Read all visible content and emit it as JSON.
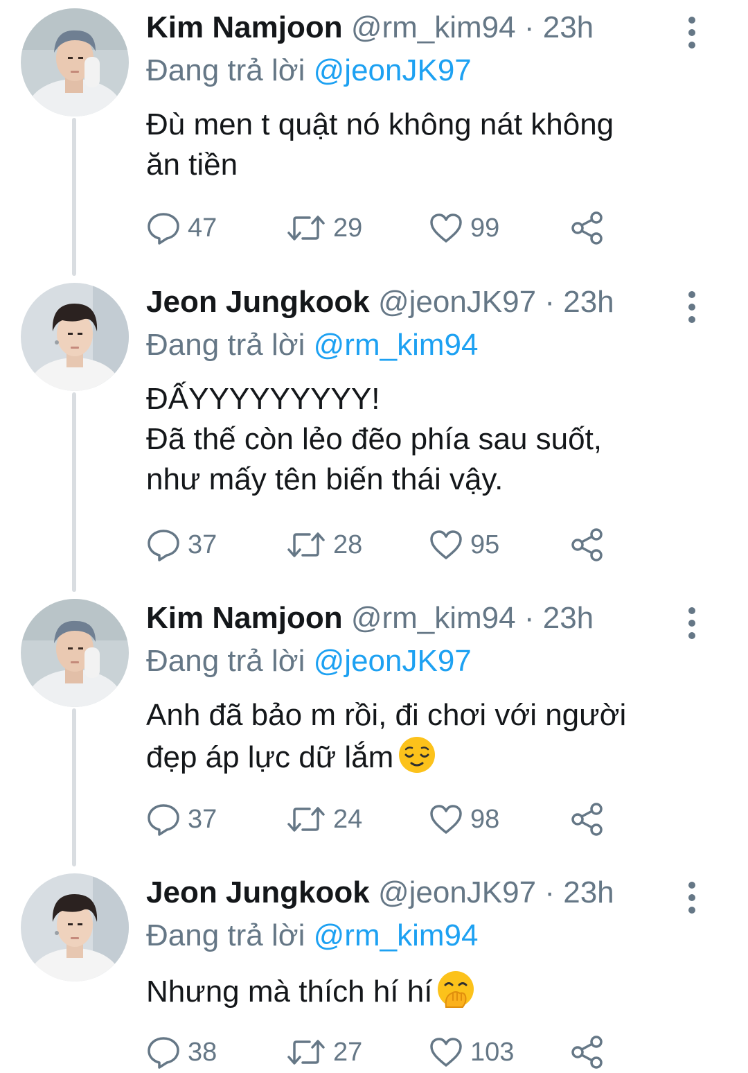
{
  "reply_prefix": "Đang trả lời",
  "tweets": [
    {
      "name": "Kim Namjoon",
      "handle": "@rm_kim94",
      "time": "23h",
      "reply_to": "@jeonJK97",
      "lines": [
        "Đù men t quật nó không nát không",
        "ăn tiền"
      ],
      "emoji": "",
      "replies": "47",
      "retweets": "29",
      "likes": "99",
      "avatar": "rm"
    },
    {
      "name": "Jeon Jungkook",
      "handle": "@jeonJK97",
      "time": "23h",
      "reply_to": "@rm_kim94",
      "lines": [
        "ĐẤYYYYYYYYY!",
        "Đã thế còn lẻo đẽo phía sau suốt,",
        "như mấy tên biến thái vậy."
      ],
      "emoji": "",
      "replies": "37",
      "retweets": "28",
      "likes": "95",
      "avatar": "jk"
    },
    {
      "name": "Kim Namjoon",
      "handle": "@rm_kim94",
      "time": "23h",
      "reply_to": "@jeonJK97",
      "lines": [
        "Anh đã bảo m rồi, đi chơi với người",
        "đẹp áp lực dữ lắm"
      ],
      "emoji": "relieved-face",
      "replies": "37",
      "retweets": "24",
      "likes": "98",
      "avatar": "rm"
    },
    {
      "name": "Jeon Jungkook",
      "handle": "@jeonJK97",
      "time": "23h",
      "reply_to": "@rm_kim94",
      "lines": [
        "Nhưng mà thích hí hí"
      ],
      "emoji": "hand-over-mouth-face",
      "replies": "38",
      "retweets": "27",
      "likes": "103",
      "avatar": "jk"
    }
  ],
  "colors": {
    "text": "#14171a",
    "secondary": "#657786",
    "link": "#1da1f2",
    "thread_line": "#d9dde1"
  },
  "icons": {
    "reply": "reply-icon",
    "retweet": "retweet-icon",
    "like": "heart-icon",
    "share": "share-icon",
    "more": "more-vertical-icon"
  }
}
